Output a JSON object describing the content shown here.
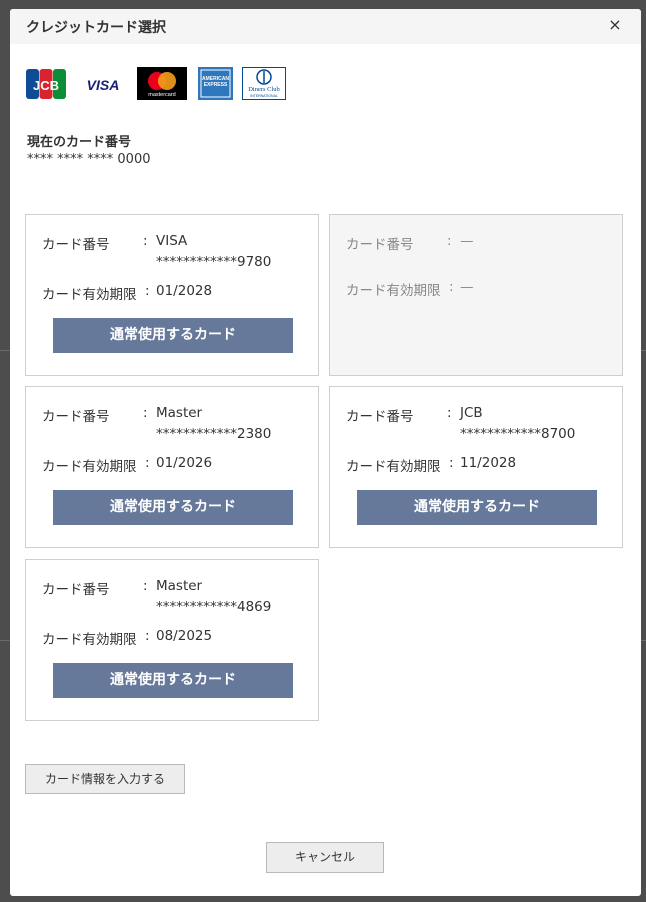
{
  "modal": {
    "title": "クレジットカード選択",
    "close_label": "×"
  },
  "brands": [
    {
      "name": "JCB"
    },
    {
      "name": "VISA"
    },
    {
      "name": "mastercard"
    },
    {
      "name": "AMERICAN EXPRESS"
    },
    {
      "name": "Diners Club",
      "sub": "INTERNATIONAL"
    }
  ],
  "current": {
    "label": "現在のカード番号",
    "number": "**** **** **** 0000"
  },
  "labels": {
    "card_number": "カード番号",
    "expiry": "カード有効期限",
    "colon": ":",
    "use_button": "通常使用するカード"
  },
  "cards": [
    {
      "brand": "VISA",
      "number": "************9780",
      "expiry": "01/2028"
    },
    {
      "brand": "—",
      "number": "",
      "expiry": "—"
    },
    {
      "brand": "Master",
      "number": "************2380",
      "expiry": "01/2026"
    },
    {
      "brand": "JCB",
      "number": "************8700",
      "expiry": "11/2028"
    },
    {
      "brand": "Master",
      "number": "************4869",
      "expiry": "08/2025"
    }
  ],
  "actions": {
    "enter_card": "カード情報を入力する",
    "cancel": "キャンセル"
  },
  "colors": {
    "button_primary": "#67799a",
    "jcb_blue": "#0e4c96",
    "jcb_red": "#d9232e",
    "jcb_green": "#0b8e36",
    "visa_blue": "#1a1f71",
    "mc_red": "#eb001b",
    "mc_yellow": "#f79e1b",
    "amex_blue": "#2e77bc",
    "diners_blue": "#004a97"
  }
}
